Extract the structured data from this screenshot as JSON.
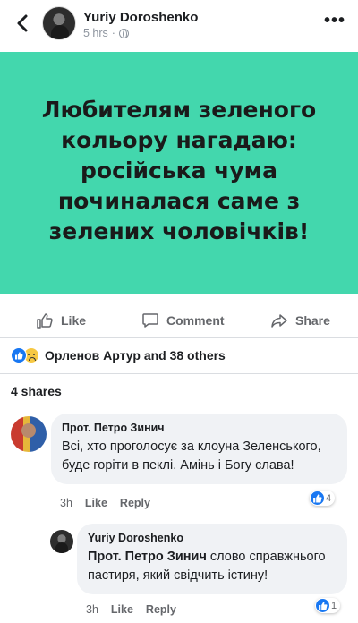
{
  "header": {
    "author": "Yuriy Doroshenko",
    "time": "5 hrs",
    "separator": "·",
    "more_label": "•••"
  },
  "post": {
    "text": "Любителям зеленого кольору нагадаю: російська чума починалася саме з зелених чоловічків!",
    "background_color": "#43d7ad"
  },
  "actions": {
    "like": "Like",
    "comment": "Comment",
    "share": "Share"
  },
  "reactions": {
    "text": "Орленов Артур and 38 others",
    "icons": [
      "like-icon",
      "sad-icon"
    ]
  },
  "shares": "4 shares",
  "comments": [
    {
      "author": "Прот. Петро Зинич",
      "text": "Всі, хто проголосує за клоуна Зеленського, буде горіти в пеклі. Амінь і Богу слава!",
      "time": "3h",
      "like_label": "Like",
      "reply_label": "Reply",
      "like_count": "4"
    },
    {
      "author": "Yuriy Doroshenko",
      "mention": "Прот. Петро Зинич",
      "text": " слово справжнього пастиря, який свідчить істину!",
      "time": "3h",
      "like_label": "Like",
      "reply_label": "Reply",
      "like_count": "1"
    }
  ],
  "colors": {
    "accent": "#1877f2",
    "bubble": "#f0f2f5",
    "meta_text": "#65676b"
  }
}
